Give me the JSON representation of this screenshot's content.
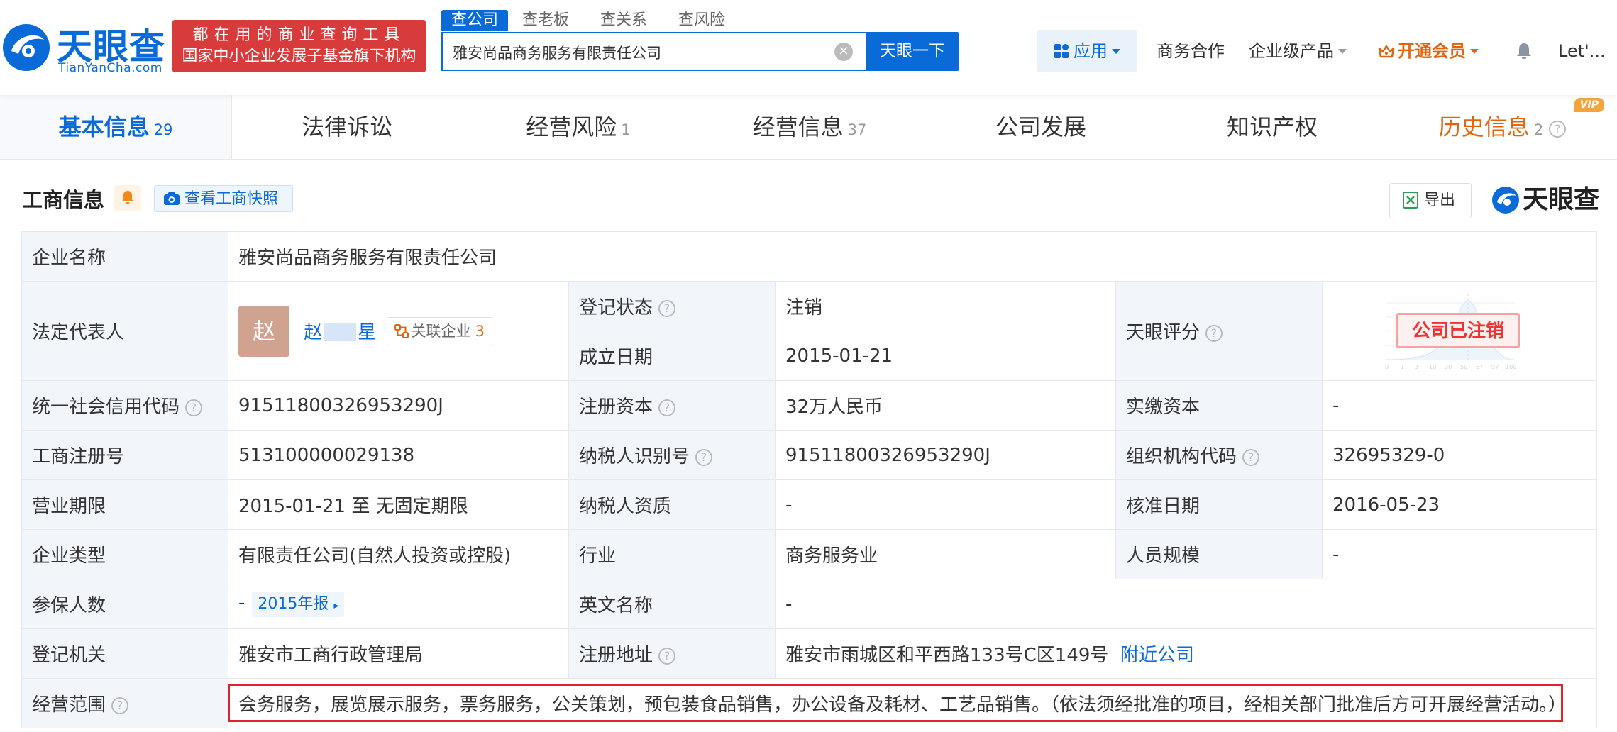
{
  "brand": {
    "name_cn": "天眼查",
    "name_en": "TianYanCha.com",
    "slogan_line1": "都在用的商业查询工具",
    "slogan_line2": "国家中小企业发展子基金旗下机构"
  },
  "search": {
    "tabs": [
      "查公司",
      "查老板",
      "查关系",
      "查风险"
    ],
    "value": "雅安尚品商务服务有限责任公司",
    "button": "天眼一下"
  },
  "nav": {
    "app": "应用",
    "business": "商务合作",
    "enterprise": "企业级产品",
    "vip": "开通会员",
    "user": "Let'..."
  },
  "tabs": [
    {
      "label": "基本信息",
      "count": "29"
    },
    {
      "label": "法律诉讼",
      "count": ""
    },
    {
      "label": "经营风险",
      "count": "1"
    },
    {
      "label": "经营信息",
      "count": "37"
    },
    {
      "label": "公司发展",
      "count": ""
    },
    {
      "label": "知识产权",
      "count": ""
    },
    {
      "label": "历史信息",
      "count": "2",
      "badge": "VIP"
    }
  ],
  "section": {
    "title": "工商信息",
    "snapshot_btn": "查看工商快照",
    "export_btn": "导出",
    "watermark": "天眼查"
  },
  "info": {
    "company_name_label": "企业名称",
    "company_name": "雅安尚品商务服务有限责任公司",
    "legal_rep_label": "法定代表人",
    "legal_rep_avatar": "赵",
    "legal_rep_first": "赵",
    "legal_rep_last": "星",
    "related_label": "关联企业",
    "related_count": "3",
    "reg_status_label": "登记状态",
    "reg_status": "注销",
    "founded_label": "成立日期",
    "founded": "2015-01-21",
    "score_label": "天眼评分",
    "score_stamp": "公司已注销",
    "credit_code_label": "统一社会信用代码",
    "credit_code": "91511800326953290J",
    "reg_capital_label": "注册资本",
    "reg_capital": "32万人民币",
    "paid_capital_label": "实缴资本",
    "paid_capital": "-",
    "reg_no_label": "工商注册号",
    "reg_no": "513100000029138",
    "taxpayer_id_label": "纳税人识别号",
    "taxpayer_id": "91511800326953290J",
    "org_code_label": "组织机构代码",
    "org_code": "32695329-0",
    "term_label": "营业期限",
    "term": "2015-01-21 至 无固定期限",
    "taxpayer_qual_label": "纳税人资质",
    "taxpayer_qual": "-",
    "approve_date_label": "核准日期",
    "approve_date": "2016-05-23",
    "type_label": "企业类型",
    "type": "有限责任公司(自然人投资或控股)",
    "industry_label": "行业",
    "industry": "商务服务业",
    "staff_label": "人员规模",
    "staff": "-",
    "insured_label": "参保人数",
    "insured": "-",
    "insured_report": "2015年报",
    "english_label": "英文名称",
    "english": "-",
    "authority_label": "登记机关",
    "authority": "雅安市工商行政管理局",
    "address_label": "注册地址",
    "address": "雅安市雨城区和平西路133号C区149号",
    "nearby": "附近公司",
    "scope_label": "经营范围",
    "scope": "会务服务，展览展示服务，票务服务，公关策划，预包装食品销售，办公设备及耗材、工艺品销售。（依法须经批准的项目，经相关部门批准后方可开展经营活动。）"
  },
  "colors": {
    "brand_blue": "#0a6ad8",
    "slogan_red": "#d83b3b",
    "vip_orange": "#e0650f",
    "status_red": "#e33333",
    "highlight_border": "#e0222c"
  }
}
